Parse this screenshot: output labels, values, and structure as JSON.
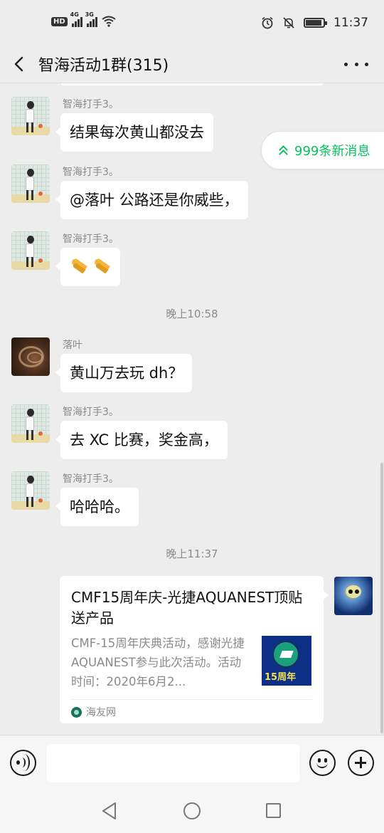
{
  "status_bar": {
    "hd_label": "HD",
    "net1": "4G",
    "net2": "3G",
    "time": "11:37",
    "battery_level": 0.85,
    "icons": [
      "hd-icon",
      "signal-4g-icon",
      "signal-3g-icon",
      "wifi-icon",
      "alarm-icon",
      "mute-icon",
      "battery-icon"
    ]
  },
  "header": {
    "title": "智海活动1群(315)",
    "back_icon": "chevron-left-icon",
    "more_icon": "more-dots-icon"
  },
  "new_messages_pill": {
    "text": "999条新消息",
    "icon": "double-chevron-up-icon",
    "color": "#07c160"
  },
  "messages": [
    {
      "sender": "智海打手3。",
      "text": "结果每次黄山都没去",
      "avatar": "player-avatar"
    },
    {
      "sender": "智海打手3。",
      "text": "@落叶  公路还是你威些，",
      "avatar": "player-avatar"
    },
    {
      "sender": "智海打手3。",
      "text": "",
      "emoji": "praying-hands-emoji",
      "avatar": "player-avatar"
    },
    {
      "sender": "落叶",
      "text": "黄山万去玩 dh？",
      "avatar": "bike-avatar"
    },
    {
      "sender": "智海打手3。",
      "text": "去 XC 比赛，奖金高，",
      "avatar": "player-avatar"
    },
    {
      "sender": "智海打手3。",
      "text": "哈哈哈。",
      "avatar": "player-avatar"
    }
  ],
  "timestamps": [
    "晚上10:58",
    "晚上11:37"
  ],
  "link_card": {
    "title": "CMF15周年庆-光捷AQUANEST顶贴送产品",
    "description": "CMF-15周年庆典活动，感谢光捷AQUANEST参与此次活动。活动时间：2020年6月2...",
    "thumb_text": "15周年",
    "source": "海友网"
  },
  "input_bar": {
    "placeholder": "",
    "value": "",
    "icons": [
      "voice-icon",
      "emoji-icon",
      "plus-icon"
    ]
  },
  "nav_bar": {
    "icons": [
      "nav-back-icon",
      "nav-home-icon",
      "nav-recents-icon"
    ]
  },
  "colors": {
    "background": "#ededed",
    "bubble": "#ffffff",
    "accent": "#07c160",
    "muted_text": "#8a8a8a"
  }
}
